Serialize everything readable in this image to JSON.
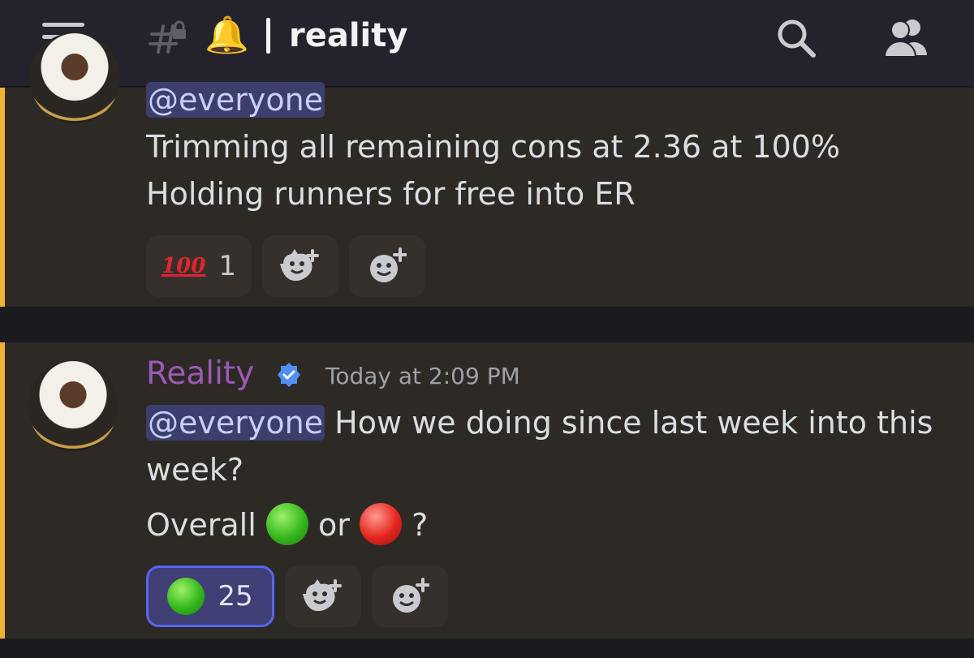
{
  "header": {
    "channel_icon": "hash-lock-icon",
    "notification_emoji": "🔔",
    "channel_name": "reality",
    "search_icon": "search-icon",
    "members_icon": "members-icon"
  },
  "messages": [
    {
      "mention": "@everyone",
      "lines": [
        "Trimming all remaining cons at 2.36 at 100%",
        "Holding runners for free into ER"
      ],
      "reactions": [
        {
          "emoji": "100",
          "count": "1"
        }
      ]
    },
    {
      "username": "Reality",
      "timestamp": "Today at 2:09 PM",
      "mention": "@everyone",
      "line1": "How we doing since last week into this",
      "line2": "week?",
      "line3_prefix": "Overall",
      "line3_mid": "or",
      "line3_suffix": "?",
      "reactions": [
        {
          "emoji": "green-circle",
          "count": "25"
        }
      ]
    }
  ],
  "colors": {
    "accent_bar": "#f0b232",
    "username": "#9b59b6",
    "mention_bg": "#3c3e6e",
    "active_reaction_border": "#5865f2"
  }
}
